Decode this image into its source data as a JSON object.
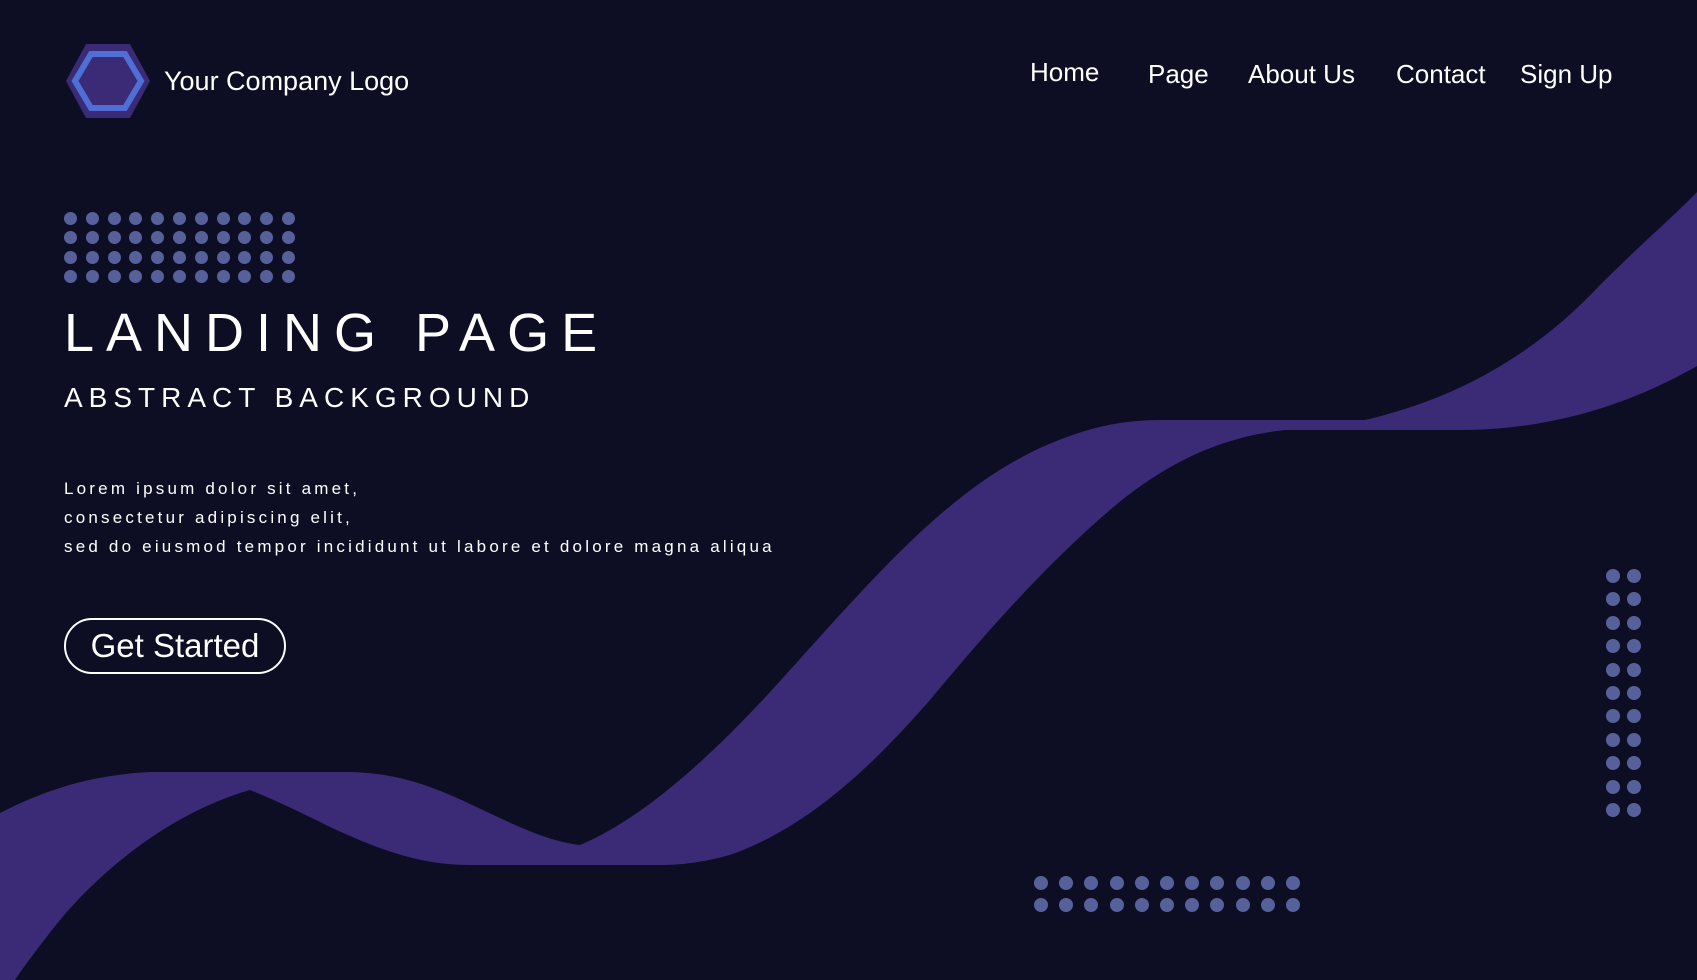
{
  "colors": {
    "background": "#0d0d24",
    "wave": "#3b2b76",
    "dots": "#56619b",
    "logo_outer": "#3b2b76",
    "logo_inner": "#4f6fd6",
    "text": "#ffffff"
  },
  "header": {
    "logo_icon": "hexagon-icon",
    "logo_text": "Your Company Logo",
    "nav": {
      "home": "Home",
      "page": "Page",
      "about": "About Us",
      "contact": "Contact",
      "signup": "Sign Up"
    }
  },
  "hero": {
    "title": "LANDING PAGE",
    "subtitle": "ABSTRACT BACKGROUND",
    "body": [
      "Lorem ipsum dolor sit amet,",
      "consectetur adipiscing elit,",
      "sed do eiusmod tempor incididunt ut labore et dolore magna aliqua"
    ],
    "cta_label": "Get Started"
  }
}
